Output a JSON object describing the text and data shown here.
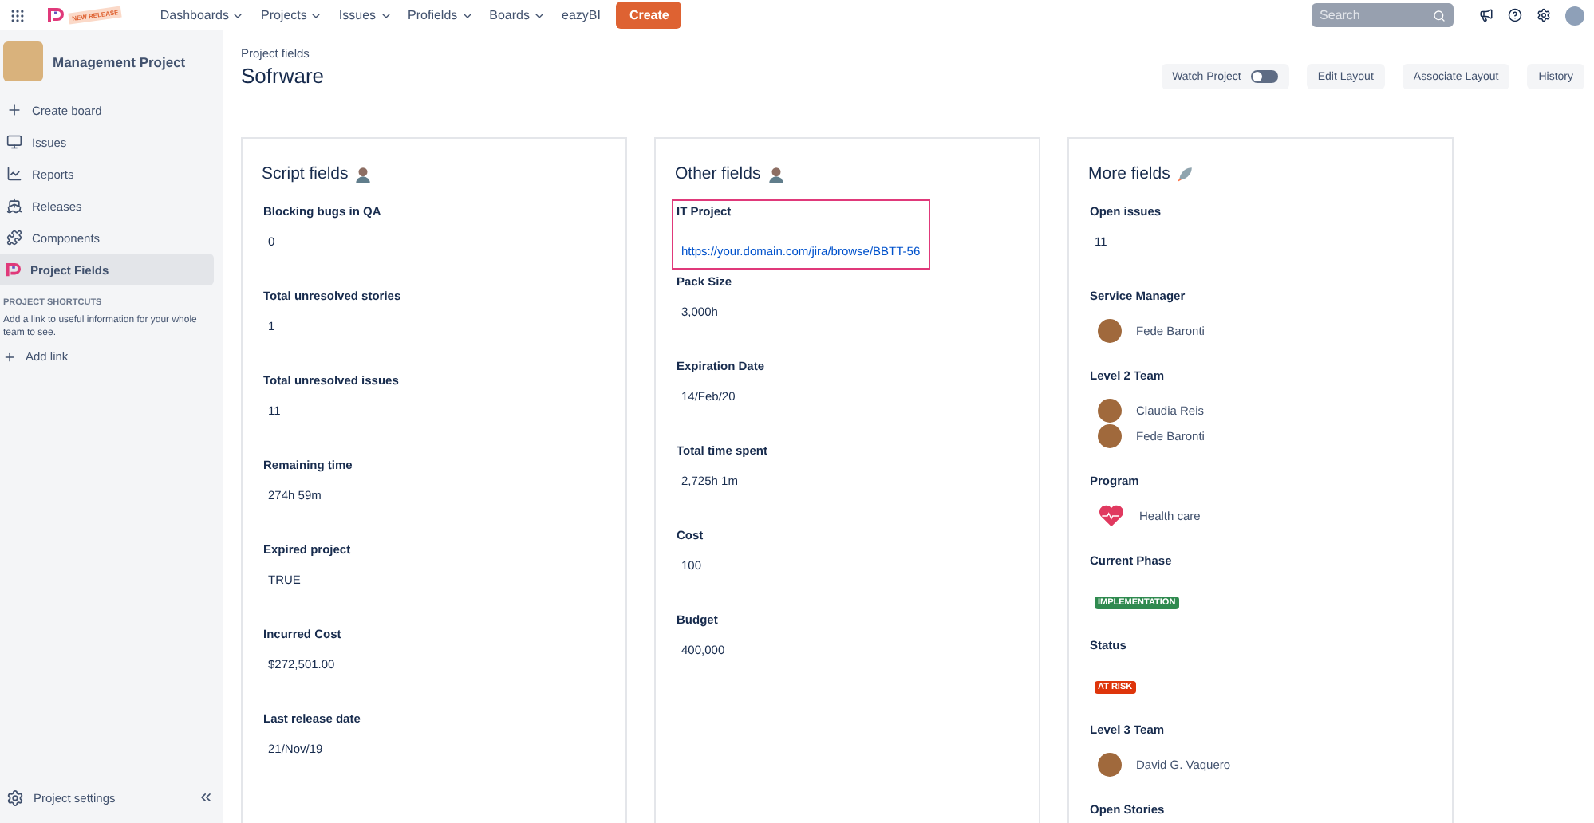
{
  "topbar": {
    "badge": "NEW RELEASE",
    "menus": [
      {
        "label": "Dashboards",
        "dropdown": true
      },
      {
        "label": "Projects",
        "dropdown": true
      },
      {
        "label": "Issues",
        "dropdown": true
      },
      {
        "label": "Profields",
        "dropdown": true
      },
      {
        "label": "Boards",
        "dropdown": true
      },
      {
        "label": "eazyBI",
        "dropdown": false
      }
    ],
    "create": "Create",
    "search": {
      "placeholder": "Search"
    }
  },
  "sidebar": {
    "project": "Management Project",
    "items": [
      {
        "label": "Create board",
        "selected": false
      },
      {
        "label": "Issues",
        "selected": false
      },
      {
        "label": "Reports",
        "selected": false
      },
      {
        "label": "Releases",
        "selected": false
      },
      {
        "label": "Components",
        "selected": false
      },
      {
        "label": "Project Fields",
        "selected": true
      }
    ],
    "shortcuts_heading": "PROJECT SHORTCUTS",
    "shortcuts_text": "Add a link to useful information for your whole team to see.",
    "add_link": "Add link",
    "settings": "Project settings"
  },
  "header": {
    "breadcrumb": "Project fields",
    "title": "Sofrware",
    "watch": {
      "label": "Watch Project",
      "on": false
    },
    "buttons": [
      "Edit Layout",
      "Associate Layout",
      "History"
    ]
  },
  "cards": [
    {
      "title": "Script fields",
      "fields": [
        {
          "label": "Blocking bugs in QA",
          "kind": "text",
          "value": "0",
          "highlighted": false
        },
        {
          "label": "Total unresolved stories",
          "kind": "text",
          "value": "1",
          "highlighted": false
        },
        {
          "label": "Total unresolved issues",
          "kind": "text",
          "value": "11",
          "highlighted": false
        },
        {
          "label": "Remaining time",
          "kind": "text",
          "value": "274h 59m",
          "highlighted": false
        },
        {
          "label": "Expired project",
          "kind": "text",
          "value": "TRUE",
          "highlighted": false
        },
        {
          "label": "Incurred Cost",
          "kind": "text",
          "value": "$272,501.00",
          "highlighted": false
        },
        {
          "label": "Last release date",
          "kind": "text",
          "value": "21/Nov/19",
          "highlighted": false
        }
      ]
    },
    {
      "title": "Other fields",
      "fields": [
        {
          "label": "IT Project",
          "kind": "link",
          "value": "https://your.domain.com/jira/browse/BBTT-56",
          "highlighted": true
        },
        {
          "label": "Pack Size",
          "kind": "text",
          "value": "3,000h",
          "highlighted": false
        },
        {
          "label": "Expiration Date",
          "kind": "text",
          "value": "14/Feb/20",
          "highlighted": false
        },
        {
          "label": "Total time spent",
          "kind": "text",
          "value": "2,725h 1m",
          "highlighted": false
        },
        {
          "label": "Cost",
          "kind": "text",
          "value": "100",
          "highlighted": false
        },
        {
          "label": "Budget",
          "kind": "text",
          "value": "400,000",
          "highlighted": false
        }
      ]
    },
    {
      "title": "More fields",
      "fields": [
        {
          "label": "Open issues",
          "kind": "text",
          "value": "11",
          "highlighted": false
        },
        {
          "label": "Service Manager",
          "kind": "users",
          "users": [
            "Fede Baronti"
          ],
          "highlighted": false
        },
        {
          "label": "Level 2 Team",
          "kind": "users",
          "users": [
            "Claudia Reis",
            "Fede Baronti"
          ],
          "highlighted": false
        },
        {
          "label": "Program",
          "kind": "option",
          "value": "Health care",
          "highlighted": false
        },
        {
          "label": "Current Phase",
          "kind": "tag",
          "value": "IMPLEMENTATION",
          "color": "#2f8a4f",
          "highlighted": false
        },
        {
          "label": "Status",
          "kind": "tag",
          "value": "AT RISK",
          "color": "#de350b",
          "highlighted": false
        },
        {
          "label": "Level 3 Team",
          "kind": "users",
          "users": [
            "David G. Vaquero"
          ],
          "highlighted": false
        },
        {
          "label": "Open Stories",
          "kind": "none",
          "highlighted": false
        }
      ]
    }
  ]
}
